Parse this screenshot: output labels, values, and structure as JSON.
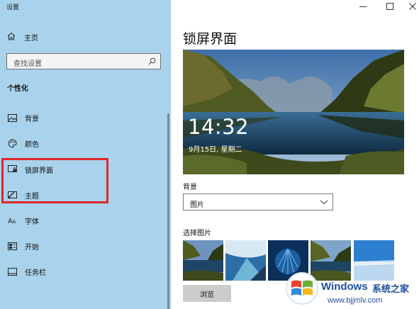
{
  "app": {
    "title": "设置"
  },
  "sidebar": {
    "home_label": "主页",
    "search_placeholder": "查找设置",
    "section_title": "个性化",
    "items": [
      {
        "label": "背景",
        "icon": "picture-icon"
      },
      {
        "label": "颜色",
        "icon": "palette-icon"
      },
      {
        "label": "锁屏界面",
        "icon": "lock-screen-icon"
      },
      {
        "label": "主题",
        "icon": "theme-icon"
      },
      {
        "label": "字体",
        "icon": "font-icon"
      },
      {
        "label": "开始",
        "icon": "start-icon"
      },
      {
        "label": "任务栏",
        "icon": "taskbar-icon"
      }
    ],
    "highlight_color": "#e0262a"
  },
  "main": {
    "title": "锁屏界面",
    "preview": {
      "time": "14:32",
      "date": "9月15日, 星期二"
    },
    "background_label": "背景",
    "background_value": "图片",
    "choose_label": "选择图片",
    "browse_label": "浏览"
  },
  "watermark": {
    "brand": "Windows",
    "brand_cn": "系统之家",
    "url": "www.bjjmlv.com"
  },
  "colors": {
    "sidebar_bg": "#a9d3ec",
    "accent": "#1d4f9e"
  }
}
